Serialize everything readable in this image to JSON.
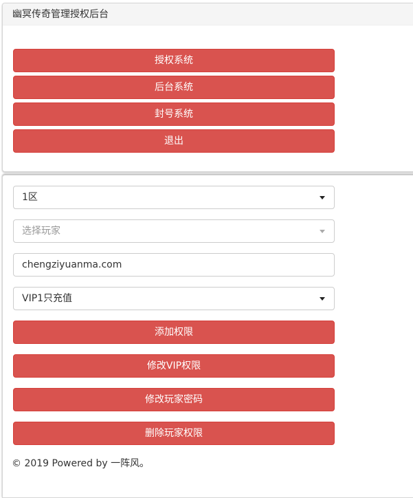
{
  "header": {
    "title": "幽冥传奇管理授权后台"
  },
  "nav": {
    "items": [
      {
        "label": "授权系统"
      },
      {
        "label": "后台系统"
      },
      {
        "label": "封号系统"
      },
      {
        "label": "退出"
      }
    ]
  },
  "form": {
    "zone_select": {
      "value": "1区"
    },
    "player_select": {
      "placeholder": "选择玩家"
    },
    "text_input": {
      "value": "chengziyuanma.com"
    },
    "vip_select": {
      "value": "VIP1只充值"
    },
    "actions": [
      {
        "label": "添加权限"
      },
      {
        "label": "修改VIP权限"
      },
      {
        "label": "修改玩家密码"
      },
      {
        "label": "删除玩家权限"
      }
    ]
  },
  "footer": {
    "text": "© 2019 Powered by 一阵风。"
  },
  "colors": {
    "button_bg": "#d9534f",
    "button_border": "#d43f3a",
    "heading_bg": "#f5f5f5"
  }
}
